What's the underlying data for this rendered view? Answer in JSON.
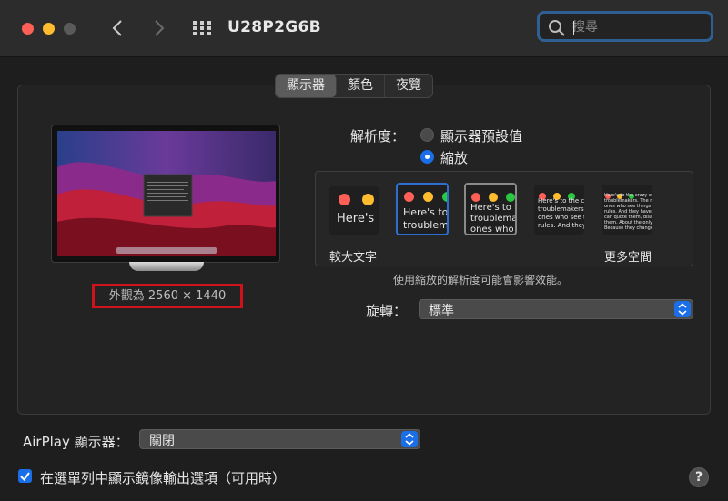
{
  "window": {
    "title": "U28P2G6B"
  },
  "search": {
    "placeholder": "搜尋"
  },
  "tabs": [
    "顯示器",
    "顏色",
    "夜覽"
  ],
  "display": {
    "size_label": "外觀為 2560 × 1440"
  },
  "resolution": {
    "label": "解析度：",
    "options": [
      "顯示器預設值",
      "縮放"
    ],
    "selected": "縮放",
    "scale_left_label": "較大文字",
    "scale_right_label": "更多空間",
    "scale_previews": [
      "Here's",
      "Here's to\ntroublem",
      "Here's to t\ntroublema\nones who",
      "Here's to the cr\ntroublemakers.\nones who see t\nrules. And they",
      "Here's to the crazy one\ntroublemakers. The roun\nones who see things dif\nrules. And they have no\ncan quote them, disagre\nthem. About the only th\nBecause they change th"
    ],
    "note": "使用縮放的解析度可能會影響效能。"
  },
  "rotation": {
    "label": "旋轉：",
    "value": "標準"
  },
  "airplay": {
    "label": "AirPlay 顯示器：",
    "value": "關閉"
  },
  "mirror": {
    "label": "在選單列中顯示鏡像輸出選項（可用時）",
    "checked": true
  },
  "colors": {
    "accent": "#1a6fe8",
    "highlight_red": "#d0131a",
    "traffic_red": "#fe5f57",
    "traffic_yellow": "#febc2e"
  }
}
